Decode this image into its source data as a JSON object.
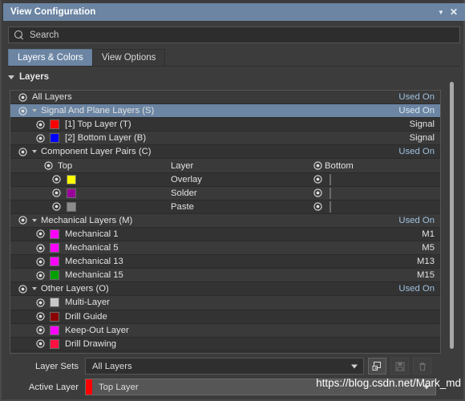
{
  "window": {
    "title": "View Configuration",
    "caret_icon": "chevron-down-icon",
    "close_icon": "close-icon"
  },
  "search": {
    "placeholder": "Search",
    "value": "",
    "icon": "search-icon"
  },
  "tabs": [
    {
      "label": "Layers & Colors",
      "active": true
    },
    {
      "label": "View Options",
      "active": false
    }
  ],
  "group": {
    "label": "Layers",
    "expanded": true
  },
  "rows": [
    {
      "type": "top",
      "indent": 0,
      "eye": true,
      "swatch": null,
      "label": "All Layers",
      "right": "Used On",
      "right_style": "accent",
      "selected": false,
      "expander": false,
      "band": "alt"
    },
    {
      "type": "group",
      "indent": 0,
      "eye": true,
      "swatch": null,
      "label": "Signal And Plane Layers (S)",
      "right": "Used On",
      "right_style": "accent",
      "selected": true,
      "expander": true,
      "band": "sel"
    },
    {
      "type": "layer",
      "indent": 1,
      "eye": true,
      "swatch": "#ff0000",
      "label": "[1] Top Layer (T)",
      "right": "Signal",
      "right_style": "plain",
      "selected": false,
      "expander": false,
      "band": "dark"
    },
    {
      "type": "layer",
      "indent": 1,
      "eye": true,
      "swatch": "#0000ff",
      "label": "[2] Bottom Layer (B)",
      "right": "Signal",
      "right_style": "plain",
      "selected": false,
      "expander": false,
      "band": "alt"
    },
    {
      "type": "group",
      "indent": 0,
      "eye": true,
      "swatch": null,
      "label": "Component Layer Pairs (C)",
      "right": "Used On",
      "right_style": "accent",
      "selected": false,
      "expander": true,
      "band": "dark"
    }
  ],
  "pair_header": {
    "top_eye": true,
    "top_label": "Top",
    "layer_label": "Layer",
    "bottom_eye": true,
    "bottom_label": "Bottom",
    "right": "",
    "band": "alt"
  },
  "pairs": [
    {
      "top_swatch": "#ffff00",
      "label": "Overlay",
      "bottom_swatch": "#8b8b00",
      "band": "dark"
    },
    {
      "top_swatch": "#990099",
      "label": "Solder",
      "bottom_swatch": "#ff00ff",
      "band": "alt"
    },
    {
      "top_swatch": "#8c8c8c",
      "label": "Paste",
      "bottom_swatch": "#990000",
      "band": "dark"
    }
  ],
  "mech_group": {
    "label": "Mechanical Layers (M)",
    "right": "Used On",
    "right_style": "accent",
    "band": "alt"
  },
  "mech_layers": [
    {
      "swatch": "#ff00ff",
      "label": "Mechanical 1",
      "right": "M1",
      "band": "dark"
    },
    {
      "swatch": "#ff00ff",
      "label": "Mechanical 5",
      "right": "M5",
      "band": "alt"
    },
    {
      "swatch": "#ff00ff",
      "label": "Mechanical 13",
      "right": "M13",
      "band": "dark"
    },
    {
      "swatch": "#00a000",
      "label": "Mechanical 15",
      "right": "M15",
      "band": "alt"
    }
  ],
  "other_group": {
    "label": "Other Layers (O)",
    "right": "Used On",
    "right_style": "accent",
    "band": "dark"
  },
  "other_layers": [
    {
      "swatch": "#c8c8c8",
      "label": "Multi-Layer",
      "right": "",
      "band": "alt"
    },
    {
      "swatch": "#8b0000",
      "label": "Drill Guide",
      "right": "",
      "band": "dark"
    },
    {
      "swatch": "#ff00ff",
      "label": "Keep-Out Layer",
      "right": "",
      "band": "alt"
    },
    {
      "swatch": "#ff1040",
      "label": "Drill Drawing",
      "right": "",
      "band": "dark"
    }
  ],
  "footer": {
    "layer_sets_label": "Layer Sets",
    "layer_sets_value": "All Layers",
    "active_layer_label": "Active Layer",
    "active_layer_value": "Top Layer",
    "active_layer_color": "#ff0000",
    "buttons": [
      {
        "name": "new-layer-set-button",
        "icon": "add-layerset-icon",
        "disabled": false
      },
      {
        "name": "save-layer-set-button",
        "icon": "save-icon",
        "disabled": true
      },
      {
        "name": "delete-layer-set-button",
        "icon": "trash-icon",
        "disabled": true
      }
    ]
  },
  "watermark": {
    "text": "https://blog.csdn.net/Mark_md"
  },
  "colors": {
    "accent": "#6b85a3",
    "panel": "#3c3c3c",
    "list_bg": "#333333",
    "used_on": "#9fc2e0"
  }
}
